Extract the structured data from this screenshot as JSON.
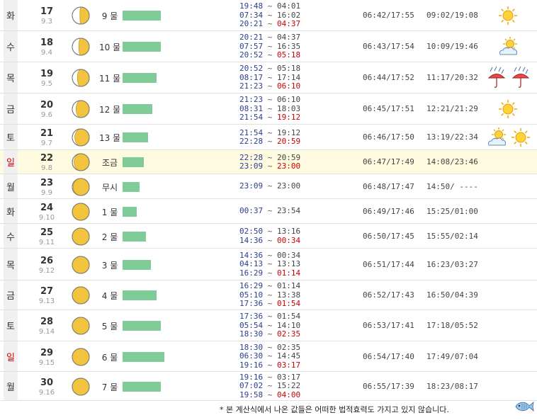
{
  "colors": {
    "tide_bar": "#7fcc99",
    "sunday_red": "#dd0000",
    "highlight_row": "#fffbe0",
    "time_blue": "#2a3f8f",
    "time_red": "#cc0000"
  },
  "rows": [
    {
      "weekday": "화",
      "weekday_class": "",
      "date": "17",
      "lunar": "9.3",
      "moon_phase": 0.55,
      "tide": "9 물",
      "tide_level": 0.9,
      "times": [
        [
          "19:48",
          "04:01",
          false
        ],
        [
          "07:34",
          "16:02",
          false
        ],
        [
          "20:21",
          "04:37",
          true
        ]
      ],
      "sun": "06:42/17:55",
      "moon": "09:02/19:08",
      "weather": [
        "sun-icon"
      ]
    },
    {
      "weekday": "수",
      "weekday_class": "",
      "date": "18",
      "lunar": "9.4",
      "moon_phase": 0.62,
      "tide": "10 물",
      "tide_level": 0.9,
      "times": [
        [
          "20:21",
          "04:37",
          false
        ],
        [
          "07:57",
          "16:35",
          false
        ],
        [
          "20:52",
          "05:18",
          true
        ]
      ],
      "sun": "06:43/17:54",
      "moon": "10:09/19:46",
      "weather": [
        "sun-cloud-icon"
      ]
    },
    {
      "weekday": "목",
      "weekday_class": "",
      "date": "19",
      "lunar": "9.5",
      "moon_phase": 0.7,
      "tide": "11 물",
      "tide_level": 0.8,
      "times": [
        [
          "20:52",
          "05:18",
          false
        ],
        [
          "08:17",
          "17:14",
          false
        ],
        [
          "21:23",
          "06:10",
          true
        ]
      ],
      "sun": "06:44/17:52",
      "moon": "11:17/20:32",
      "weather": [
        "rain-umbrella-icon",
        "rain-umbrella-icon"
      ]
    },
    {
      "weekday": "금",
      "weekday_class": "",
      "date": "20",
      "lunar": "9.6",
      "moon_phase": 0.78,
      "tide": "12 물",
      "tide_level": 0.7,
      "times": [
        [
          "21:23",
          "06:10",
          false
        ],
        [
          "08:31",
          "18:03",
          false
        ],
        [
          "21:54",
          "19:12",
          true
        ]
      ],
      "sun": "06:45/17:51",
      "moon": "12:21/21:29",
      "weather": [
        "sun-icon"
      ]
    },
    {
      "weekday": "토",
      "weekday_class": "",
      "date": "21",
      "lunar": "9.7",
      "moon_phase": 0.85,
      "tide": "13 물",
      "tide_level": 0.6,
      "times": [
        [
          "21:54",
          "19:12",
          false
        ],
        [
          "22:28",
          "20:59",
          true
        ]
      ],
      "sun": "06:46/17:50",
      "moon": "13:19/22:34",
      "weather": [
        "sun-cloud-icon",
        "sun-icon"
      ]
    },
    {
      "weekday": "일",
      "weekday_class": "sun",
      "highlight": true,
      "date": "22",
      "lunar": "9.8",
      "moon_phase": 0.9,
      "tide": "조금",
      "tide_level": 0.5,
      "times": [
        [
          "22:28",
          "20:59",
          false
        ],
        [
          "23:09",
          "23:00",
          true
        ]
      ],
      "sun": "06:47/17:49",
      "moon": "14:08/23:46",
      "weather": []
    },
    {
      "weekday": "월",
      "weekday_class": "",
      "date": "23",
      "lunar": "9.9",
      "moon_phase": 0.95,
      "tide": "무시",
      "tide_level": 0.4,
      "times": [
        [
          "23:09",
          "23:00",
          false
        ]
      ],
      "sun": "06:48/17:47",
      "moon": "14:50/ ----",
      "weather": []
    },
    {
      "weekday": "화",
      "weekday_class": "",
      "date": "24",
      "lunar": "9.10",
      "moon_phase": 1.0,
      "tide": "1 물",
      "tide_level": 0.33,
      "times": [
        [
          "00:37",
          "23:54",
          false
        ]
      ],
      "sun": "06:49/17:46",
      "moon": "15:25/01:00",
      "weather": []
    },
    {
      "weekday": "수",
      "weekday_class": "",
      "date": "25",
      "lunar": "9.11",
      "moon_phase": 1.05,
      "tide": "2 물",
      "tide_level": 0.55,
      "times": [
        [
          "02:50",
          "13:16",
          false
        ],
        [
          "14:36",
          "00:34",
          true
        ]
      ],
      "sun": "06:50/17:45",
      "moon": "15:55/02:14",
      "weather": []
    },
    {
      "weekday": "목",
      "weekday_class": "",
      "date": "26",
      "lunar": "9.12",
      "moon_phase": 1.1,
      "tide": "3 물",
      "tide_level": 0.66,
      "times": [
        [
          "14:36",
          "00:34",
          false
        ],
        [
          "04:13",
          "13:13",
          false
        ],
        [
          "16:29",
          "01:14",
          true
        ]
      ],
      "sun": "06:51/17:44",
      "moon": "16:23/03:27",
      "weather": []
    },
    {
      "weekday": "금",
      "weekday_class": "",
      "date": "27",
      "lunar": "9.13",
      "moon_phase": 1.15,
      "tide": "4 물",
      "tide_level": 0.8,
      "times": [
        [
          "16:29",
          "01:14",
          false
        ],
        [
          "05:10",
          "13:38",
          false
        ],
        [
          "17:36",
          "01:54",
          true
        ]
      ],
      "sun": "06:52/17:43",
      "moon": "16:50/04:39",
      "weather": []
    },
    {
      "weekday": "토",
      "weekday_class": "",
      "date": "28",
      "lunar": "9.14",
      "moon_phase": 1.2,
      "tide": "5 물",
      "tide_level": 0.9,
      "times": [
        [
          "17:36",
          "01:54",
          false
        ],
        [
          "05:54",
          "14:10",
          false
        ],
        [
          "18:30",
          "02:35",
          true
        ]
      ],
      "sun": "06:53/17:41",
      "moon": "17:18/05:52",
      "weather": []
    },
    {
      "weekday": "일",
      "weekday_class": "sun",
      "date": "29",
      "lunar": "9.15",
      "moon_phase": 1.25,
      "tide": "6 물",
      "tide_level": 0.98,
      "times": [
        [
          "18:30",
          "02:35",
          false
        ],
        [
          "06:30",
          "14:45",
          false
        ],
        [
          "19:16",
          "03:17",
          true
        ]
      ],
      "sun": "06:54/17:40",
      "moon": "17:49/07:04",
      "weather": []
    },
    {
      "weekday": "월",
      "weekday_class": "",
      "date": "30",
      "lunar": "9.16",
      "moon_phase": 1.3,
      "tide": "7 물",
      "tide_level": 0.9,
      "times": [
        [
          "19:16",
          "03:17",
          false
        ],
        [
          "07:02",
          "15:22",
          false
        ],
        [
          "19:58",
          "04:00",
          true
        ]
      ],
      "sun": "06:55/17:39",
      "moon": "18:23/08:17",
      "weather": []
    }
  ],
  "footnote": "* 본 계산식에서 나온 값들은 어떠한 법적효력도 가지고 있지 않습니다.",
  "icons": {
    "fish": "fish-icon"
  }
}
